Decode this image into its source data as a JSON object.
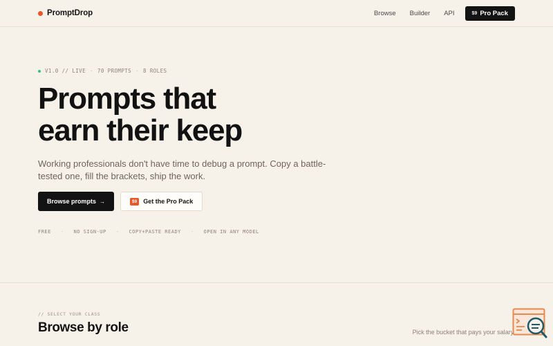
{
  "nav": {
    "brand": "PromptDrop",
    "links": [
      "Browse",
      "Builder",
      "API"
    ],
    "pro_price": "$9",
    "pro_label": "Pro Pack"
  },
  "hero": {
    "version": "V1.0 // LIVE",
    "stats_prompts": "70 PROMPTS",
    "stats_roles": "8 ROLES",
    "headline_line1": "Prompts that",
    "headline_line2": "earn their keep",
    "subtitle": "Working professionals don't have time to debug a prompt. Copy a battle-tested one, fill the brackets, ship the work.",
    "cta_primary": "Browse prompts",
    "cta_secondary_price": "$9",
    "cta_secondary": "Get the Pro Pack",
    "features": [
      "FREE",
      "NO SIGN-UP",
      "COPY+PASTE READY",
      "OPEN IN ANY MODEL"
    ]
  },
  "browse": {
    "eyebrow": "// SELECT YOUR CLASS",
    "title": "Browse by role",
    "subtitle": "Pick the bucket that pays your salary."
  },
  "colors": {
    "accent": "#e8562a",
    "live": "#33c27a",
    "background": "#f6f1e9",
    "ink": "#131313"
  },
  "icons": {
    "brand": "brand-dot-icon",
    "arrow": "arrow-right-icon",
    "floating": "search-document-icon"
  }
}
